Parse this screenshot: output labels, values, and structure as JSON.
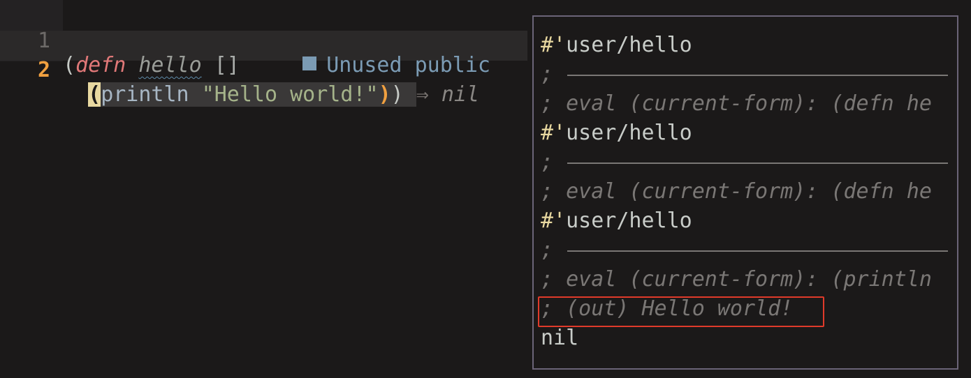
{
  "editor": {
    "line1": {
      "number": "1",
      "open_paren": "(",
      "keyword": "defn",
      "fn_name": "hello",
      "params": "[]",
      "diagnostic": "Unused public"
    },
    "line2": {
      "number": "2",
      "open_paren": "(",
      "call": "println",
      "string": "\"Hello world!\"",
      "close_inner": ")",
      "close_outer": ")",
      "arrow": "⇒",
      "virtual_result": "nil"
    }
  },
  "log_window": {
    "lines": [
      {
        "type": "var",
        "hash": "#'",
        "name": "user/hello"
      },
      {
        "type": "separator",
        "text": ";"
      },
      {
        "type": "comment",
        "text": "; eval (current-form): (defn he"
      },
      {
        "type": "var",
        "hash": "#'",
        "name": "user/hello"
      },
      {
        "type": "separator",
        "text": ";"
      },
      {
        "type": "comment",
        "text": "; eval (current-form): (defn he"
      },
      {
        "type": "var",
        "hash": "#'",
        "name": "user/hello"
      },
      {
        "type": "separator",
        "text": ";"
      },
      {
        "type": "comment",
        "text": "; eval (current-form): (println"
      },
      {
        "type": "comment",
        "text": "; (out) Hello world!"
      },
      {
        "type": "value",
        "text": "nil"
      }
    ],
    "highlight_color": "#e03a2a"
  },
  "colors": {
    "background": "#1b1919",
    "keyword": "#e07878",
    "string": "#a5b38a",
    "diagnostic": "#7b9bb4",
    "cursor_line_number": "#f0a040",
    "border": "#6b6478"
  }
}
